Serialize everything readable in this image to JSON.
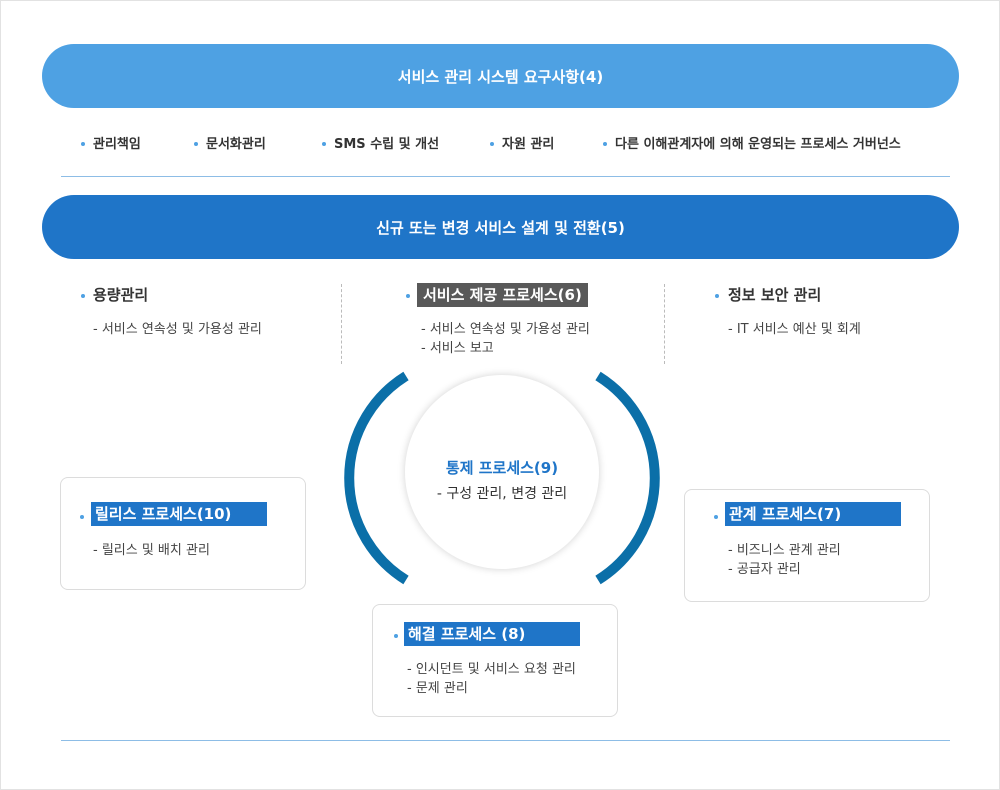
{
  "header": {
    "requirements_title": "서비스 관리 시스템 요구사항(4)",
    "requirements": [
      "관리책임",
      "문서화관리",
      "SMS 수립 및 개선",
      "자원 관리",
      "다른 이해관계자에 의해 운영되는 프로세스 거버넌스"
    ],
    "design_title": "신규 또는 변경 서비스 설계 및 전환(5)"
  },
  "columns": {
    "capacity": {
      "title": "용량관리",
      "items": [
        "- 서비스 연속성 및 가용성 관리"
      ]
    },
    "delivery": {
      "title": "서비스 제공 프로세스(6)",
      "items": [
        "- 서비스 연속성 및 가용성 관리",
        "- 서비스 보고"
      ]
    },
    "security": {
      "title": "정보 보안 관리",
      "items": [
        "- IT 서비스 예산 및 회계"
      ]
    }
  },
  "release": {
    "title": "릴리스 프로세스(10)",
    "items": [
      "- 릴리스 및 배치 관리"
    ]
  },
  "relationship": {
    "title": "관계 프로세스(7)",
    "items": [
      "- 비즈니스 관계 관리",
      "- 공급자 관리"
    ]
  },
  "resolution": {
    "title": "해결 프로세스 (8)",
    "items": [
      "- 인시던트 및 서비스 요청 관리",
      "- 문제 관리"
    ]
  },
  "control": {
    "title": "통제 프로세스(9)",
    "subtitle": "- 구성 관리, 변경 관리"
  },
  "colors": {
    "light_blue": "#4ea1e3",
    "blue": "#1f75c8",
    "dark_gray": "#595959",
    "arc_blue": "#0b6fa8"
  }
}
